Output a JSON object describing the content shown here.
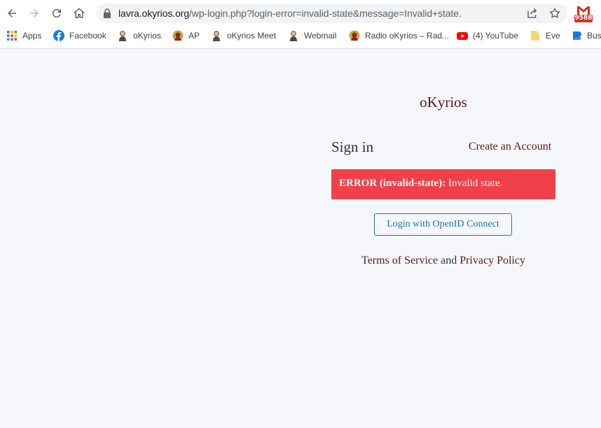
{
  "browser": {
    "url_host": "lavra.okyrios.org",
    "url_path": "/wp-login.php?login-error=invalid-state&message=Invalid+state.",
    "gmail_count": "9588",
    "bookmarks": [
      {
        "label": "Apps",
        "icon": "apps-grid-icon"
      },
      {
        "label": "Facebook",
        "icon": "facebook-icon"
      },
      {
        "label": "oKyrios",
        "icon": "okyrios-icon"
      },
      {
        "label": "AP",
        "icon": "ap-icon"
      },
      {
        "label": "oKyrios Meet",
        "icon": "okyrios-meet-icon"
      },
      {
        "label": "Webmail",
        "icon": "webmail-icon"
      },
      {
        "label": "Radio oKyrios – Rad...",
        "icon": "radio-icon"
      },
      {
        "label": "(4) YouTube",
        "icon": "youtube-icon"
      },
      {
        "label": "Eve",
        "icon": "folder-icon"
      },
      {
        "label": "Busi",
        "icon": "business-icon"
      }
    ]
  },
  "page": {
    "site_title": "oKyrios",
    "sign_in": "Sign in",
    "create_account": "Create an Account",
    "error_label": "ERROR (invalid-state):",
    "error_message": " Invalid state.",
    "oidc_button": "Login with OpenID Connect",
    "terms_link": "Terms of Service",
    "legal_and": " and ",
    "privacy_link": "Privacy Policy"
  },
  "colors": {
    "accent": "#5a1a14",
    "error_bg": "#f0404a",
    "button_border": "#2271b1",
    "page_bg": "#f6f7fb"
  }
}
